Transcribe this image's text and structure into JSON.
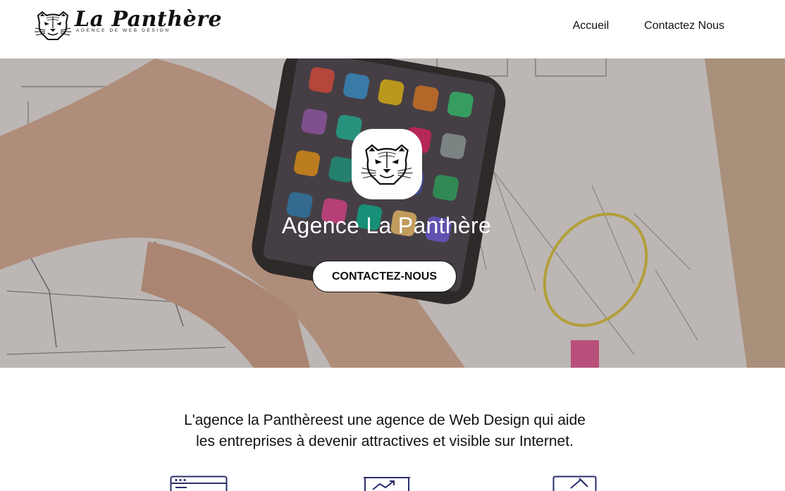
{
  "header": {
    "logo": {
      "name": "La Panthère",
      "tagline": "AGENCE DE WEB DESIGN",
      "icon": "panther-head-icon"
    },
    "nav": [
      {
        "label": "Accueil"
      },
      {
        "label": "Contactez Nous"
      }
    ]
  },
  "hero": {
    "badge_icon": "panther-head-icon",
    "title": "Agence La Panthère",
    "cta_label": "CONTACTEZ-NOUS"
  },
  "intro": {
    "line1": "L'agence la Panthèreest une agence de Web Design qui aide",
    "line2": "les entreprises à devenir attractives et visible sur Internet."
  },
  "features": [
    {
      "icon": "browser-window-icon"
    },
    {
      "icon": "analytics-board-icon"
    },
    {
      "icon": "image-editing-icon"
    }
  ],
  "colors": {
    "icon_navy": "#2b2e6b",
    "text": "#111111",
    "background": "#ffffff"
  }
}
